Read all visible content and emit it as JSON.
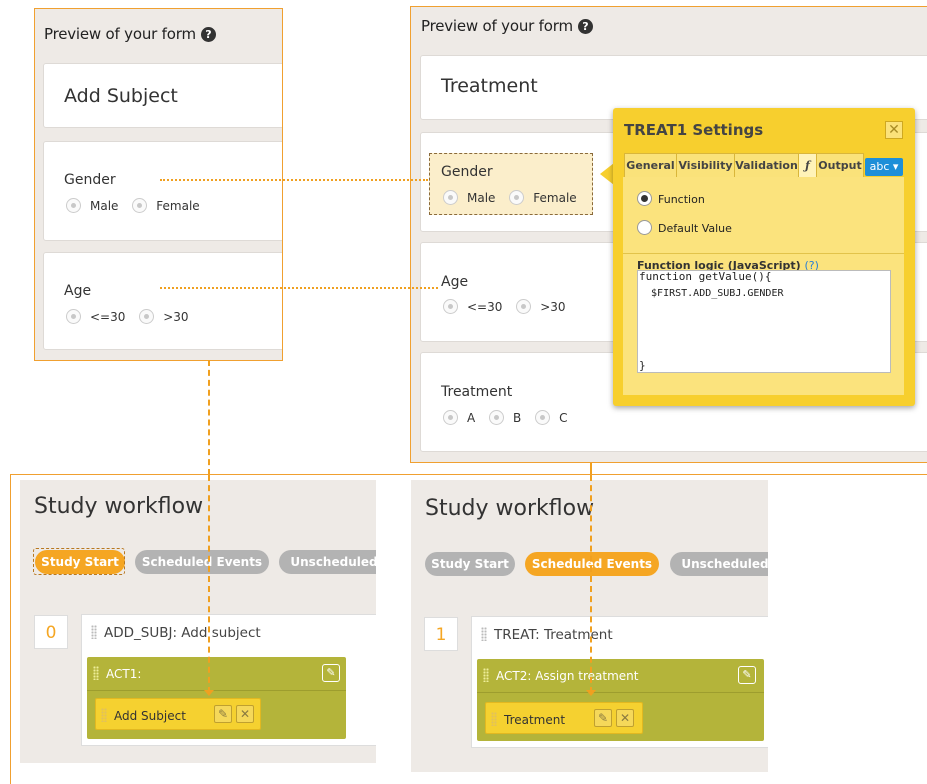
{
  "left_preview": {
    "title": "Preview of your form",
    "form_name": "Add Subject",
    "fields": [
      {
        "label": "Gender",
        "options": [
          "Male",
          "Female"
        ]
      },
      {
        "label": "Age",
        "options": [
          "<=30",
          ">30"
        ]
      }
    ]
  },
  "right_preview": {
    "title": "Preview of your form",
    "form_name": "Treatment",
    "fields": [
      {
        "label": "Gender",
        "options": [
          "Male",
          "Female"
        ]
      },
      {
        "label": "Age",
        "options": [
          "<=30",
          ">30"
        ]
      },
      {
        "label": "Treatment",
        "options": [
          "A",
          "B",
          "C"
        ]
      }
    ]
  },
  "settings_popup": {
    "title": "TREAT1 Settings",
    "close": "✕",
    "tabs": [
      "General",
      "Visibility",
      "Validation",
      "ƒ",
      "Output"
    ],
    "abc_dropdown": "abc ▾",
    "radio_function": "Function",
    "radio_default": "Default Value",
    "function_label": "Function logic (JavaScript)",
    "function_help": "(?)",
    "code": [
      "function getValue(){",
      "  $FIRST.ADD_SUBJ.GENDER",
      "}"
    ]
  },
  "left_workflow": {
    "title": "Study workflow",
    "tabs": [
      "Study Start",
      "Scheduled Events",
      "Unscheduled"
    ],
    "step_number": "0",
    "step_name": "ADD_SUBJ: Add subject",
    "activity": "ACT1:",
    "form": "Add Subject"
  },
  "right_workflow": {
    "title": "Study workflow",
    "tabs": [
      "Study Start",
      "Scheduled Events",
      "Unscheduled"
    ],
    "step_number": "1",
    "step_name": "TREAT: Treatment",
    "activity": "ACT2: Assign treatment",
    "form": "Treatment"
  },
  "colors": {
    "accent_orange": "#f5a623",
    "activity_olive": "#b4b43a",
    "popup_yellow": "#f7cf2e",
    "panel_bg": "#eeeae6"
  },
  "icons": {
    "help": "question-circle-icon",
    "edit": "pencil-icon",
    "remove": "close-icon",
    "drag": "drag-handle-icon"
  }
}
